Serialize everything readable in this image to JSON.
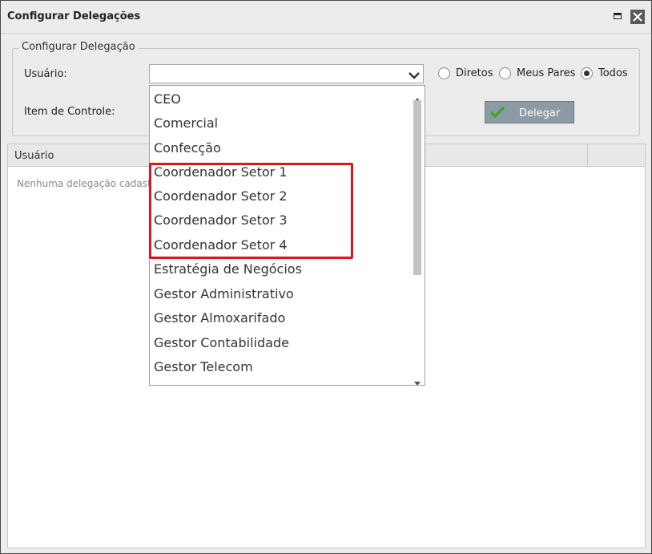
{
  "window": {
    "title": "Configurar Delegações"
  },
  "form": {
    "legend": "Configurar Delegação",
    "usuario_label": "Usuário:",
    "item_controle_label": "Item de Controle:",
    "usuario_value": "",
    "radios": [
      {
        "label": "Diretos",
        "checked": false
      },
      {
        "label": "Meus Pares",
        "checked": false
      },
      {
        "label": "Todos",
        "checked": true
      }
    ],
    "delegate_label": "Delegar"
  },
  "grid": {
    "columns": [
      "Usuário",
      ""
    ],
    "empty_message": "Nenhuma delegação cadast"
  },
  "dropdown": {
    "options": [
      "CEO",
      "Comercial",
      "Confecção",
      "Coordenador Setor 1",
      "Coordenador Setor 2",
      "Coordenador Setor 3",
      "Coordenador Setor 4",
      "Estratégia de Negócios",
      "Gestor Administrativo",
      "Gestor Almoxarifado",
      "Gestor Contabilidade",
      "Gestor Telecom"
    ]
  },
  "colors": {
    "highlight": "#e0151c",
    "button": "#8c9aa6",
    "check": "#3aa52f"
  },
  "icons": [
    "maximize-icon",
    "close-icon",
    "chevron-down-icon",
    "check-icon",
    "scroll-up-icon",
    "scroll-down-icon"
  ]
}
